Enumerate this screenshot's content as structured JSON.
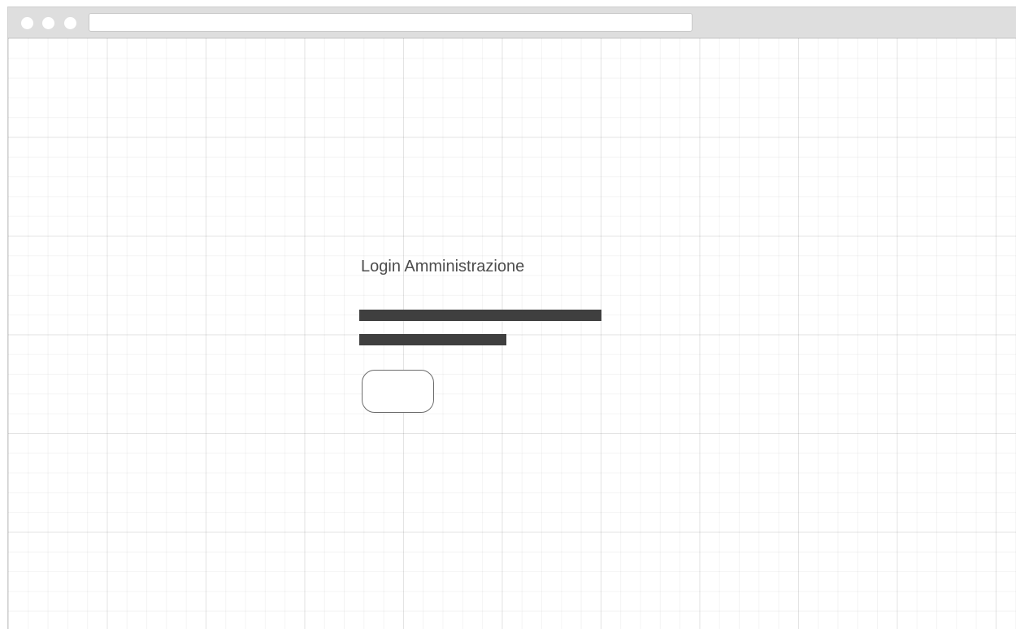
{
  "page": {
    "title": "Login Amministrazione"
  },
  "browser": {
    "address": ""
  },
  "form": {
    "username_field": "",
    "password_field": "",
    "submit_label": ""
  },
  "colors": {
    "titlebar": "#dedede",
    "text": "#4d4d4d",
    "field_fill": "#3f3f3f",
    "button_border": "#6b6b6b"
  }
}
